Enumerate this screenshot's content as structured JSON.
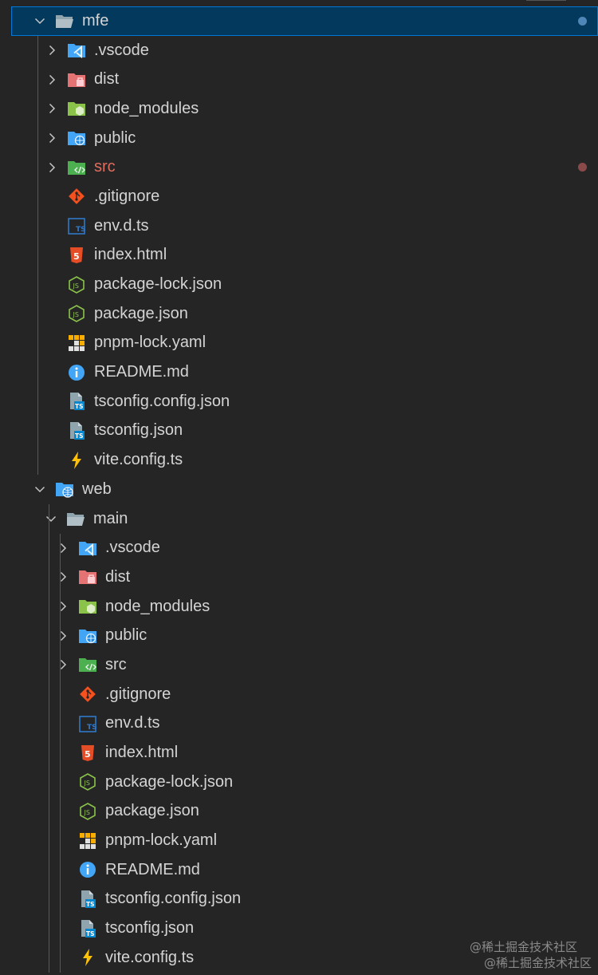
{
  "explorer": {
    "folders": [
      {
        "name": "mfe",
        "selected": true,
        "badge_color": "#4f86b8",
        "children": [
          {
            "name": ".vscode",
            "type": "folder",
            "icon": "vscode-folder-icon"
          },
          {
            "name": "dist",
            "type": "folder",
            "icon": "dist-folder-icon"
          },
          {
            "name": "node_modules",
            "type": "folder",
            "icon": "node-folder-icon"
          },
          {
            "name": "public",
            "type": "folder",
            "icon": "public-folder-icon"
          },
          {
            "name": "src",
            "type": "folder",
            "icon": "src-folder-icon",
            "modified": true
          },
          {
            "name": ".gitignore",
            "type": "file",
            "icon": "git-icon"
          },
          {
            "name": "env.d.ts",
            "type": "file",
            "icon": "ts-icon"
          },
          {
            "name": "index.html",
            "type": "file",
            "icon": "html-icon"
          },
          {
            "name": "package-lock.json",
            "type": "file",
            "icon": "nodejs-icon"
          },
          {
            "name": "package.json",
            "type": "file",
            "icon": "nodejs-icon"
          },
          {
            "name": "pnpm-lock.yaml",
            "type": "file",
            "icon": "pnpm-icon"
          },
          {
            "name": "README.md",
            "type": "file",
            "icon": "info-icon"
          },
          {
            "name": "tsconfig.config.json",
            "type": "file",
            "icon": "tsconfig-icon"
          },
          {
            "name": "tsconfig.json",
            "type": "file",
            "icon": "tsconfig-icon"
          },
          {
            "name": "vite.config.ts",
            "type": "file",
            "icon": "vite-icon"
          }
        ]
      },
      {
        "name": "web",
        "selected": false,
        "children": [
          {
            "name": "main",
            "children": [
              {
                "name": ".vscode",
                "type": "folder",
                "icon": "vscode-folder-icon"
              },
              {
                "name": "dist",
                "type": "folder",
                "icon": "dist-folder-icon"
              },
              {
                "name": "node_modules",
                "type": "folder",
                "icon": "node-folder-icon"
              },
              {
                "name": "public",
                "type": "folder",
                "icon": "public-folder-icon"
              },
              {
                "name": "src",
                "type": "folder",
                "icon": "src-folder-icon"
              },
              {
                "name": ".gitignore",
                "type": "file",
                "icon": "git-icon"
              },
              {
                "name": "env.d.ts",
                "type": "file",
                "icon": "ts-icon"
              },
              {
                "name": "index.html",
                "type": "file",
                "icon": "html-icon"
              },
              {
                "name": "package-lock.json",
                "type": "file",
                "icon": "nodejs-icon"
              },
              {
                "name": "package.json",
                "type": "file",
                "icon": "nodejs-icon"
              },
              {
                "name": "pnpm-lock.yaml",
                "type": "file",
                "icon": "pnpm-icon"
              },
              {
                "name": "README.md",
                "type": "file",
                "icon": "info-icon"
              },
              {
                "name": "tsconfig.config.json",
                "type": "file",
                "icon": "tsconfig-icon"
              },
              {
                "name": "tsconfig.json",
                "type": "file",
                "icon": "tsconfig-icon"
              },
              {
                "name": "vite.config.ts",
                "type": "file",
                "icon": "vite-icon"
              }
            ]
          }
        ]
      }
    ],
    "modified_color": "#e06c5e",
    "modified_dot_color": "#8b4a4a"
  },
  "watermark": {
    "line1": "@稀土掘金技术社区",
    "line2": "@稀土掘金技术社区"
  }
}
